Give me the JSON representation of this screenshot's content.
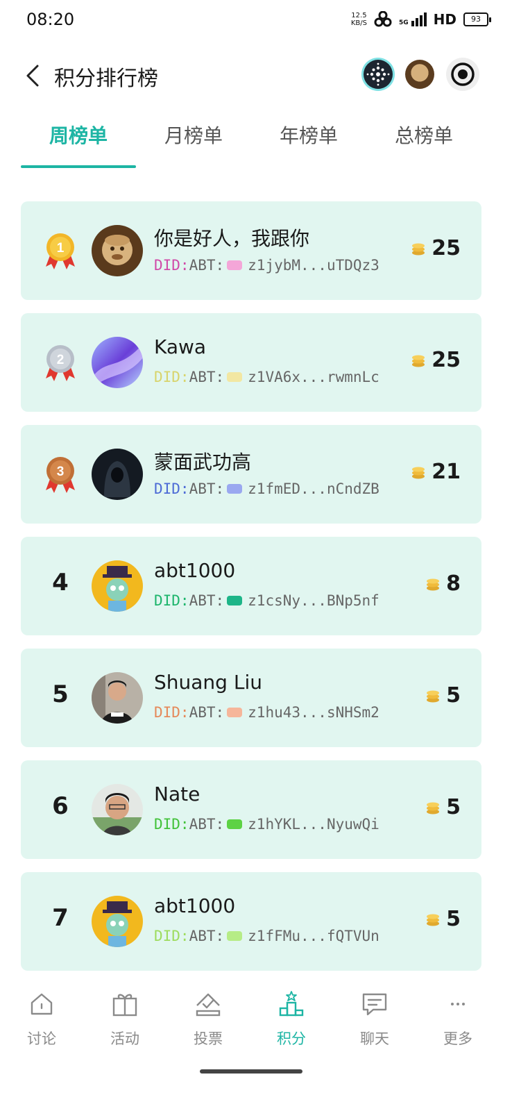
{
  "status_bar": {
    "time": "08:20",
    "net_speed_value": "12.5",
    "net_speed_unit": "KB/S",
    "network_label": "5G",
    "hd_label": "HD",
    "battery": "93"
  },
  "header": {
    "title": "积分排行榜",
    "back_icon": "chevron-left-icon"
  },
  "tabs": [
    {
      "label": "周榜单",
      "active": true
    },
    {
      "label": "月榜单",
      "active": false
    },
    {
      "label": "年榜单",
      "active": false
    },
    {
      "label": "总榜单",
      "active": false
    }
  ],
  "ranking": [
    {
      "rank": "1",
      "medal": "gold",
      "name": "你是好人，我跟你",
      "did_prefix": "DID:",
      "did_type": "ABT:",
      "did_addr": "z1jybM...uTDQz3",
      "did_color": "#d04aa8",
      "did_icon_color": "#f4a6d8",
      "score": "25"
    },
    {
      "rank": "2",
      "medal": "silver",
      "name": "Kawa",
      "did_prefix": "DID:",
      "did_type": "ABT:",
      "did_addr": "z1VA6x...rwmnLc",
      "did_color": "#d8d46c",
      "did_icon_color": "#f2e7a2",
      "score": "25"
    },
    {
      "rank": "3",
      "medal": "bronze",
      "name": "蒙面武功高",
      "did_prefix": "DID:",
      "did_type": "ABT:",
      "did_addr": "z1fmED...nCndZB",
      "did_color": "#4d6bd6",
      "did_icon_color": "#9aa8f0",
      "score": "21"
    },
    {
      "rank": "4",
      "medal": "",
      "name": "abt1000",
      "did_prefix": "DID:",
      "did_type": "ABT:",
      "did_addr": "z1csNy...BNp5nf",
      "did_color": "#1db56c",
      "did_icon_color": "#1db588",
      "score": "8"
    },
    {
      "rank": "5",
      "medal": "",
      "name": "Shuang Liu",
      "did_prefix": "DID:",
      "did_type": "ABT:",
      "did_addr": "z1hu43...sNHSm2",
      "did_color": "#e5895a",
      "did_icon_color": "#f6b69a",
      "score": "5"
    },
    {
      "rank": "6",
      "medal": "",
      "name": "Nate",
      "did_prefix": "DID:",
      "did_type": "ABT:",
      "did_addr": "z1hYKL...NyuwQi",
      "did_color": "#42c23a",
      "did_icon_color": "#5dd244",
      "score": "5"
    },
    {
      "rank": "7",
      "medal": "",
      "name": "abt1000",
      "did_prefix": "DID:",
      "did_type": "ABT:",
      "did_addr": "z1fFMu...fQTVUn",
      "did_color": "#9edc5e",
      "did_icon_color": "#b6ec86",
      "score": "5"
    }
  ],
  "bottom_nav": [
    {
      "label": "讨论",
      "icon": "home-icon",
      "active": false
    },
    {
      "label": "活动",
      "icon": "gift-icon",
      "active": false
    },
    {
      "label": "投票",
      "icon": "vote-icon",
      "active": false
    },
    {
      "label": "积分",
      "icon": "podium-icon",
      "active": true
    },
    {
      "label": "聊天",
      "icon": "chat-icon",
      "active": false
    },
    {
      "label": "更多",
      "icon": "more-icon",
      "active": false
    }
  ],
  "colors": {
    "accent": "#1db5a4",
    "card_bg": "#e1f6f0",
    "gold": "#f2b628",
    "silver": "#b7bec8",
    "bronze": "#c06f36",
    "ribbon": "#e0382f",
    "coin": "#f2c04a"
  }
}
